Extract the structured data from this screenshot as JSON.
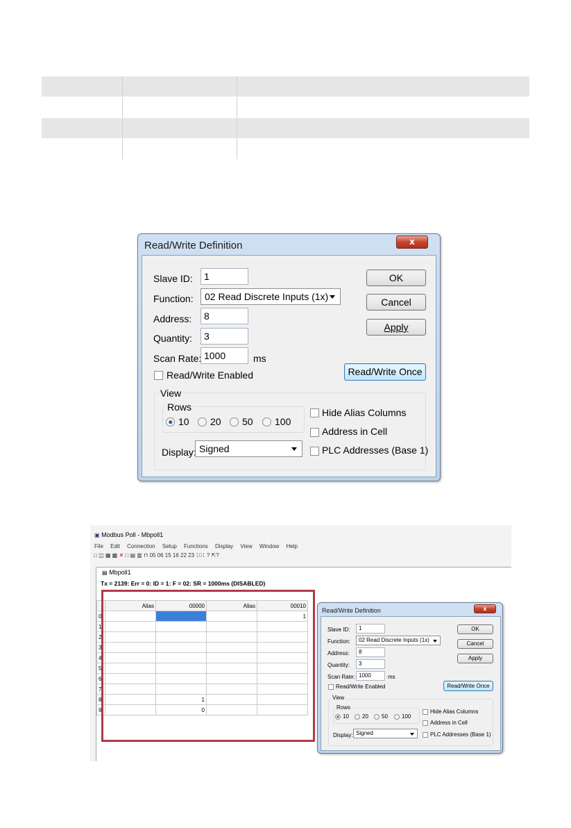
{
  "dialog": {
    "title": "Read/Write Definition",
    "close_symbol": "x",
    "slave_id_label": "Slave ID:",
    "slave_id_value": "1",
    "function_label": "Function:",
    "function_value": "02 Read Discrete Inputs (1x)",
    "address_label": "Address:",
    "address_value": "8",
    "quantity_label": "Quantity:",
    "quantity_value": "3",
    "scan_rate_label": "Scan Rate:",
    "scan_rate_value": "1000",
    "scan_rate_unit": "ms",
    "rw_enabled_label": "Read/Write Enabled",
    "ok_label": "OK",
    "cancel_label": "Cancel",
    "apply_label": "Apply",
    "rw_once_label": "Read/Write Once",
    "view_label": "View",
    "rows_label": "Rows",
    "rows_options": [
      "10",
      "20",
      "50",
      "100"
    ],
    "rows_selected": "10",
    "display_label": "Display:",
    "display_value": "Signed",
    "hide_alias_label": "Hide Alias Columns",
    "address_in_cell_label": "Address in Cell",
    "plc_addresses_label": "PLC Addresses (Base 1)"
  },
  "modbus": {
    "title": "Modbus Poll - Mbpoll1",
    "menu": [
      "File",
      "Edit",
      "Connection",
      "Setup",
      "Functions",
      "Display",
      "View",
      "Window",
      "Help"
    ],
    "toolbar_codes": "05  06  15  16  22  23",
    "toolbar_101": "101",
    "doc_title": "Mbpoll1",
    "status": "Tx = 2139: Err = 0: ID = 1: F = 02: SR = 1000ms  (DISABLED)",
    "grid_headers": [
      "Alias",
      "00000",
      "Alias",
      "00010"
    ],
    "row_numbers": [
      "0",
      "1",
      "2",
      "3",
      "4",
      "5",
      "6",
      "7",
      "8",
      "9"
    ],
    "col2_values": [
      "",
      "",
      "",
      "",
      "",
      "",
      "",
      "",
      "1",
      "0"
    ],
    "col4_values": [
      "1",
      "",
      "",
      "",
      "",
      "",
      "",
      "",
      "",
      ""
    ]
  },
  "colors": {
    "highlight_box": "#b03a48",
    "selected_cell": "#3b80d8",
    "title_bar": "#cfe0f3"
  }
}
